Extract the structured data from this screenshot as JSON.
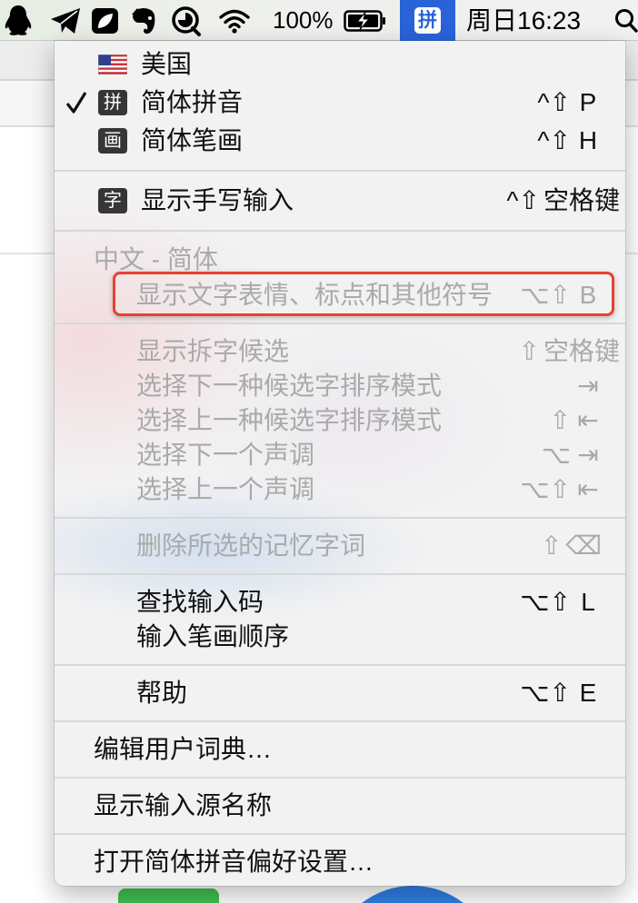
{
  "menubar": {
    "status_icons": [
      {
        "icon": "qq-penguin-icon"
      },
      {
        "icon": "paper-plane-icon"
      },
      {
        "icon": "note-app-icon"
      },
      {
        "icon": "evernote-icon"
      },
      {
        "icon": "qq-browser-icon"
      },
      {
        "icon": "wifi-icon"
      }
    ],
    "battery_percent": "100%",
    "battery_icon": "battery-charging-icon",
    "input_source_glyph": "拼",
    "clock": "周日16:23",
    "search_icon": "spotlight-search-icon"
  },
  "input_menu": {
    "input_sources": [
      {
        "icon": "us-flag-icon",
        "label": "美国",
        "checked": false
      },
      {
        "icon_glyph": "拼",
        "label": "简体拼音",
        "checked": true,
        "shortcut": {
          "modifiers": "^⇧",
          "key": "P"
        }
      },
      {
        "icon_glyph": "画",
        "label": "简体笔画",
        "checked": false,
        "shortcut": {
          "modifiers": "^⇧",
          "key": "H"
        }
      }
    ],
    "handwriting": {
      "icon_glyph": "字",
      "label": "显示手写输入",
      "shortcut": {
        "modifiers": "^⇧",
        "key": "空格键"
      }
    },
    "section_header": "中文 - 简体",
    "emoji_symbols": {
      "label": "显示文字表情、标点和其他符号",
      "disabled": true,
      "shortcut": {
        "modifiers": "⌥⇧",
        "key": "B"
      }
    },
    "candidate_options": [
      {
        "label": "显示拆字候选",
        "disabled": true,
        "shortcut": {
          "modifiers": "⇧",
          "key": "空格键"
        }
      },
      {
        "label": "选择下一种候选字排序模式",
        "disabled": true,
        "shortcut": {
          "key": "⇥"
        }
      },
      {
        "label": "选择上一种候选字排序模式",
        "disabled": true,
        "shortcut": {
          "modifiers": "⇧",
          "key": "⇤"
        }
      },
      {
        "label": "选择下一个声调",
        "disabled": true,
        "shortcut": {
          "modifiers": "⌥",
          "key": "⇥"
        }
      },
      {
        "label": "选择上一个声调",
        "disabled": true,
        "shortcut": {
          "modifiers": "⌥⇧",
          "key": "⇤"
        }
      }
    ],
    "delete_memorized": {
      "label": "删除所选的记忆字词",
      "disabled": true,
      "shortcut": {
        "modifiers": "⇧",
        "key": "⌫"
      }
    },
    "lookup": [
      {
        "label": "查找输入码",
        "shortcut": {
          "modifiers": "⌥⇧",
          "key": "L"
        }
      },
      {
        "label": "输入笔画顺序"
      }
    ],
    "help": {
      "label": "帮助",
      "shortcut": {
        "modifiers": "⌥⇧",
        "key": "E"
      }
    },
    "edit_user_dictionary": "编辑用户词典…",
    "show_input_source_name": "显示输入源名称",
    "open_preferences": "打开简体拼音偏好设置…"
  },
  "colors": {
    "menu_text": "#111111",
    "disabled_text": "#aaaaaa",
    "menubar_selected": "#2a62d8",
    "icon_box": "#363636",
    "annotation_box": "#e8412f"
  }
}
